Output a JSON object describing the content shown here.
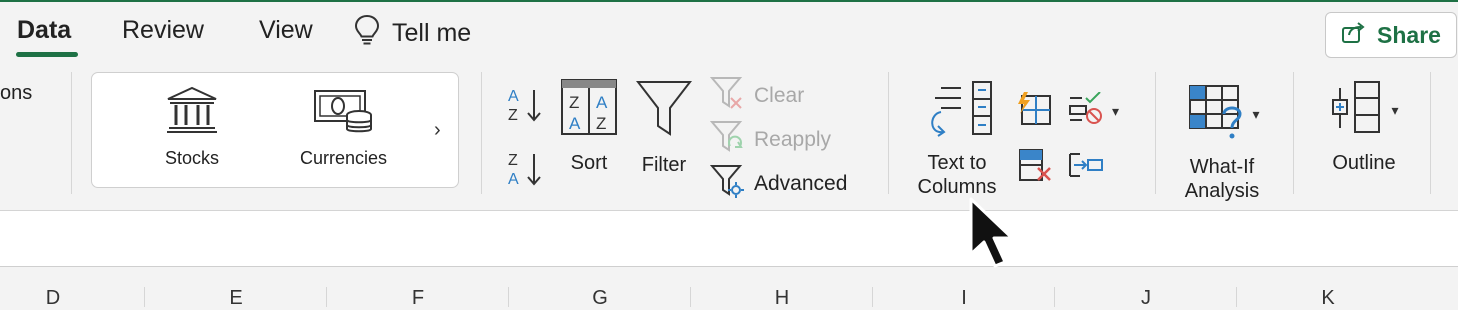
{
  "tabs": [
    {
      "label": "Data",
      "active": true
    },
    {
      "label": "Review",
      "active": false
    },
    {
      "label": "View",
      "active": false
    }
  ],
  "tell_me": {
    "label": "Tell me",
    "icon": "lightbulb-icon"
  },
  "share": {
    "label": "Share",
    "icon": "share-icon"
  },
  "ribbon": {
    "partial_label": "ons",
    "data_types": {
      "stocks": "Stocks",
      "currencies": "Currencies",
      "more_icon": "chevron-right-icon"
    },
    "sort_filter": {
      "sort": "Sort",
      "filter": "Filter",
      "clear": "Clear",
      "reapply": "Reapply",
      "advanced": "Advanced"
    },
    "data_tools": {
      "text_to_columns_line1": "Text to",
      "text_to_columns_line2": "Columns"
    },
    "forecast": {
      "what_if_line1": "What-If",
      "what_if_line2": "Analysis"
    },
    "outline": {
      "label": "Outline"
    }
  },
  "columns": [
    "D",
    "E",
    "F",
    "G",
    "H",
    "I",
    "J",
    "K"
  ],
  "colors": {
    "accent": "#1e7145",
    "icon_blue": "#3a85c9",
    "icon_red": "#d9534f",
    "icon_orange": "#f0a020",
    "icon_green": "#3aa55c"
  }
}
